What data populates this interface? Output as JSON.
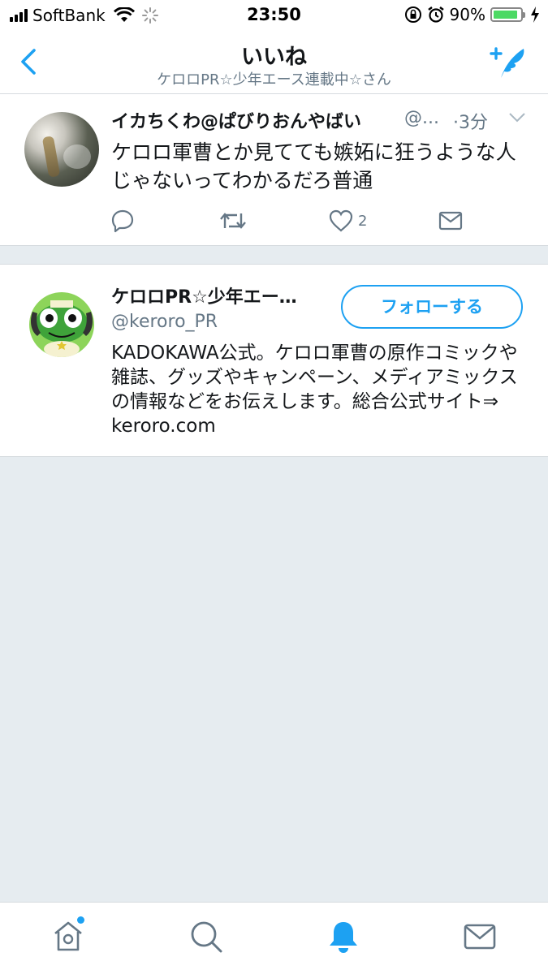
{
  "status_bar": {
    "carrier": "SoftBank",
    "time": "23:50",
    "battery_percent": "90%",
    "battery_level": 0.9
  },
  "nav": {
    "title": "いいね",
    "subtitle": "ケロロPR☆少年エース連載中☆さん",
    "accent_color": "#1da1f2"
  },
  "tweet": {
    "author_name": "イカちくわ@ぱびりおんやばい",
    "author_handle": "@...",
    "time": "·3分",
    "text": "ケロロ軍曹とか見てても嫉妬に狂うような人じゃないってわかるだろ普通",
    "like_count": "2",
    "icons": [
      "reply-icon",
      "retweet-icon",
      "like-icon",
      "direct-message-icon",
      "caret-down-icon"
    ]
  },
  "user_card": {
    "name": "ケロロPR☆少年エー…",
    "handle": "@keroro_PR",
    "follow_label": "フォローする",
    "bio": "KADOKAWA公式。ケロロ軍曹の原作コミックや雑誌、グッズやキャンペーン、メディアミックスの情報などをお伝えします。総合公式サイト⇒ keroro.com"
  },
  "tab_bar": {
    "items": [
      "home-icon",
      "search-icon",
      "notifications-icon",
      "messages-icon"
    ],
    "active": "notifications-icon"
  }
}
